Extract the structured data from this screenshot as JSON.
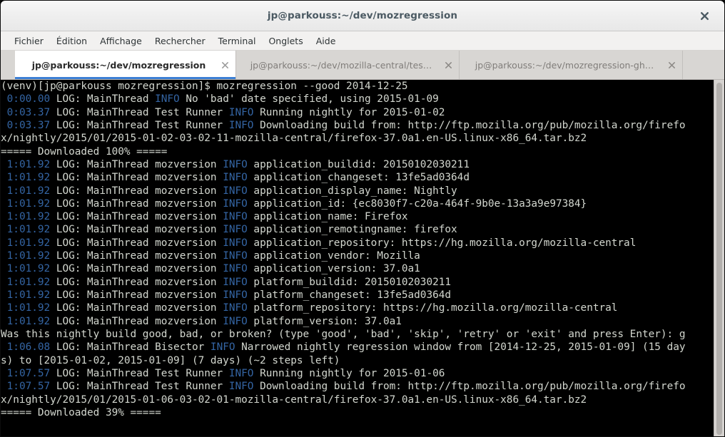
{
  "window": {
    "title": "jp@parkouss:~/dev/mozregression",
    "close_label": "✕"
  },
  "menubar": {
    "items": [
      {
        "label": "Fichier"
      },
      {
        "label": "Édition"
      },
      {
        "label": "Affichage"
      },
      {
        "label": "Rechercher"
      },
      {
        "label": "Terminal"
      },
      {
        "label": "Onglets"
      },
      {
        "label": "Aide"
      }
    ]
  },
  "tabs": [
    {
      "label": "jp@parkouss:~/dev/mozregression",
      "active": true,
      "close_label": "✕"
    },
    {
      "label": "jp@parkouss:~/dev/mozilla-central/tes…",
      "active": false,
      "close_label": "✕"
    },
    {
      "label": "jp@parkouss:~/dev/mozregression-gh…",
      "active": false,
      "close_label": "✕"
    }
  ],
  "terminal": {
    "colors": {
      "background": "#000000",
      "foreground": "#d3d7cf",
      "blue": "#3465a4"
    },
    "lines": [
      [
        {
          "t": "(venv)[jp@parkouss mozregression]$ mozregression --good 2014-12-25",
          "c": "white"
        }
      ],
      [
        {
          "t": " ",
          "c": "white"
        },
        {
          "t": "0:00.00",
          "c": "blue"
        },
        {
          "t": " LOG: MainThread ",
          "c": "white"
        },
        {
          "t": "INFO",
          "c": "blue"
        },
        {
          "t": " No 'bad' date specified, using 2015-01-09",
          "c": "white"
        }
      ],
      [
        {
          "t": " ",
          "c": "white"
        },
        {
          "t": "0:03.37",
          "c": "blue"
        },
        {
          "t": " LOG: MainThread Test Runner ",
          "c": "white"
        },
        {
          "t": "INFO",
          "c": "blue"
        },
        {
          "t": " Running nightly for 2015-01-02",
          "c": "white"
        }
      ],
      [
        {
          "t": " ",
          "c": "white"
        },
        {
          "t": "0:03.37",
          "c": "blue"
        },
        {
          "t": " LOG: MainThread Test Runner ",
          "c": "white"
        },
        {
          "t": "INFO",
          "c": "blue"
        },
        {
          "t": " Downloading build from: http://ftp.mozilla.org/pub/mozilla.org/firefo",
          "c": "white"
        }
      ],
      [
        {
          "t": "x/nightly/2015/01/2015-01-02-03-02-11-mozilla-central/firefox-37.0a1.en-US.linux-x86_64.tar.bz2",
          "c": "white"
        }
      ],
      [
        {
          "t": "===== Downloaded 100% =====",
          "c": "white"
        }
      ],
      [
        {
          "t": " ",
          "c": "white"
        },
        {
          "t": "1:01.92",
          "c": "blue"
        },
        {
          "t": " LOG: MainThread mozversion ",
          "c": "white"
        },
        {
          "t": "INFO",
          "c": "blue"
        },
        {
          "t": " application_buildid: 20150102030211",
          "c": "white"
        }
      ],
      [
        {
          "t": " ",
          "c": "white"
        },
        {
          "t": "1:01.92",
          "c": "blue"
        },
        {
          "t": " LOG: MainThread mozversion ",
          "c": "white"
        },
        {
          "t": "INFO",
          "c": "blue"
        },
        {
          "t": " application_changeset: 13fe5ad0364d",
          "c": "white"
        }
      ],
      [
        {
          "t": " ",
          "c": "white"
        },
        {
          "t": "1:01.92",
          "c": "blue"
        },
        {
          "t": " LOG: MainThread mozversion ",
          "c": "white"
        },
        {
          "t": "INFO",
          "c": "blue"
        },
        {
          "t": " application_display_name: Nightly",
          "c": "white"
        }
      ],
      [
        {
          "t": " ",
          "c": "white"
        },
        {
          "t": "1:01.92",
          "c": "blue"
        },
        {
          "t": " LOG: MainThread mozversion ",
          "c": "white"
        },
        {
          "t": "INFO",
          "c": "blue"
        },
        {
          "t": " application_id: {ec8030f7-c20a-464f-9b0e-13a3a9e97384}",
          "c": "white"
        }
      ],
      [
        {
          "t": " ",
          "c": "white"
        },
        {
          "t": "1:01.92",
          "c": "blue"
        },
        {
          "t": " LOG: MainThread mozversion ",
          "c": "white"
        },
        {
          "t": "INFO",
          "c": "blue"
        },
        {
          "t": " application_name: Firefox",
          "c": "white"
        }
      ],
      [
        {
          "t": " ",
          "c": "white"
        },
        {
          "t": "1:01.92",
          "c": "blue"
        },
        {
          "t": " LOG: MainThread mozversion ",
          "c": "white"
        },
        {
          "t": "INFO",
          "c": "blue"
        },
        {
          "t": " application_remotingname: firefox",
          "c": "white"
        }
      ],
      [
        {
          "t": " ",
          "c": "white"
        },
        {
          "t": "1:01.92",
          "c": "blue"
        },
        {
          "t": " LOG: MainThread mozversion ",
          "c": "white"
        },
        {
          "t": "INFO",
          "c": "blue"
        },
        {
          "t": " application_repository: https://hg.mozilla.org/mozilla-central",
          "c": "white"
        }
      ],
      [
        {
          "t": " ",
          "c": "white"
        },
        {
          "t": "1:01.92",
          "c": "blue"
        },
        {
          "t": " LOG: MainThread mozversion ",
          "c": "white"
        },
        {
          "t": "INFO",
          "c": "blue"
        },
        {
          "t": " application_vendor: Mozilla",
          "c": "white"
        }
      ],
      [
        {
          "t": " ",
          "c": "white"
        },
        {
          "t": "1:01.92",
          "c": "blue"
        },
        {
          "t": " LOG: MainThread mozversion ",
          "c": "white"
        },
        {
          "t": "INFO",
          "c": "blue"
        },
        {
          "t": " application_version: 37.0a1",
          "c": "white"
        }
      ],
      [
        {
          "t": " ",
          "c": "white"
        },
        {
          "t": "1:01.92",
          "c": "blue"
        },
        {
          "t": " LOG: MainThread mozversion ",
          "c": "white"
        },
        {
          "t": "INFO",
          "c": "blue"
        },
        {
          "t": " platform_buildid: 20150102030211",
          "c": "white"
        }
      ],
      [
        {
          "t": " ",
          "c": "white"
        },
        {
          "t": "1:01.92",
          "c": "blue"
        },
        {
          "t": " LOG: MainThread mozversion ",
          "c": "white"
        },
        {
          "t": "INFO",
          "c": "blue"
        },
        {
          "t": " platform_changeset: 13fe5ad0364d",
          "c": "white"
        }
      ],
      [
        {
          "t": " ",
          "c": "white"
        },
        {
          "t": "1:01.92",
          "c": "blue"
        },
        {
          "t": " LOG: MainThread mozversion ",
          "c": "white"
        },
        {
          "t": "INFO",
          "c": "blue"
        },
        {
          "t": " platform_repository: https://hg.mozilla.org/mozilla-central",
          "c": "white"
        }
      ],
      [
        {
          "t": " ",
          "c": "white"
        },
        {
          "t": "1:01.92",
          "c": "blue"
        },
        {
          "t": " LOG: MainThread mozversion ",
          "c": "white"
        },
        {
          "t": "INFO",
          "c": "blue"
        },
        {
          "t": " platform_version: 37.0a1",
          "c": "white"
        }
      ],
      [
        {
          "t": "Was this nightly build good, bad, or broken? (type 'good', 'bad', 'skip', 'retry' or 'exit' and press Enter): g",
          "c": "white"
        }
      ],
      [
        {
          "t": " ",
          "c": "white"
        },
        {
          "t": "1:06.08",
          "c": "blue"
        },
        {
          "t": " LOG: MainThread Bisector ",
          "c": "white"
        },
        {
          "t": "INFO",
          "c": "blue"
        },
        {
          "t": " Narrowed nightly regression window from [2014-12-25, 2015-01-09] (15 day",
          "c": "white"
        }
      ],
      [
        {
          "t": "s) to [2015-01-02, 2015-01-09] (7 days) (~2 steps left)",
          "c": "white"
        }
      ],
      [
        {
          "t": " ",
          "c": "white"
        },
        {
          "t": "1:07.57",
          "c": "blue"
        },
        {
          "t": " LOG: MainThread Test Runner ",
          "c": "white"
        },
        {
          "t": "INFO",
          "c": "blue"
        },
        {
          "t": " Running nightly for 2015-01-06",
          "c": "white"
        }
      ],
      [
        {
          "t": " ",
          "c": "white"
        },
        {
          "t": "1:07.57",
          "c": "blue"
        },
        {
          "t": " LOG: MainThread Test Runner ",
          "c": "white"
        },
        {
          "t": "INFO",
          "c": "blue"
        },
        {
          "t": " Downloading build from: http://ftp.mozilla.org/pub/mozilla.org/firefo",
          "c": "white"
        }
      ],
      [
        {
          "t": "x/nightly/2015/01/2015-01-06-03-02-01-mozilla-central/firefox-37.0a1.en-US.linux-x86_64.tar.bz2",
          "c": "white"
        }
      ],
      [
        {
          "t": "===== Downloaded 39% =====",
          "c": "white"
        }
      ]
    ]
  }
}
